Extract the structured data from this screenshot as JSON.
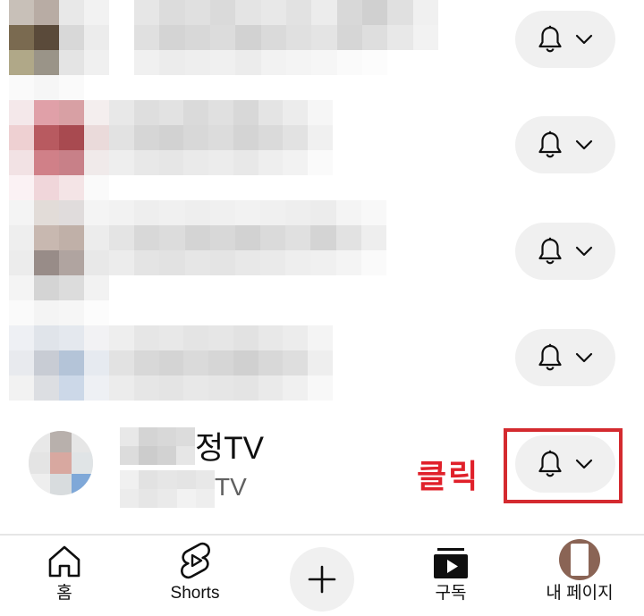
{
  "subscriptions": {
    "rows": [
      {
        "name": "",
        "sub": "",
        "notify_state": "bell-icon"
      },
      {
        "name": "",
        "sub": "",
        "notify_state": "bell-icon"
      },
      {
        "name": "",
        "sub": "",
        "notify_state": "bell-icon"
      },
      {
        "name": "",
        "sub": "",
        "notify_state": "bell-icon"
      },
      {
        "name": "정TV",
        "sub": "TV",
        "notify_state": "bell-icon"
      }
    ]
  },
  "annotation": {
    "label": "클릭",
    "color": "#e0202a"
  },
  "bottom_nav": {
    "home_label": "홈",
    "shorts_label": "Shorts",
    "subscriptions_label": "구독",
    "mypage_label": "내 페이지"
  },
  "colors": {
    "pill_bg": "#f0f0f0",
    "highlight": "#d42a2f",
    "avatar_me": "#8a6455"
  }
}
